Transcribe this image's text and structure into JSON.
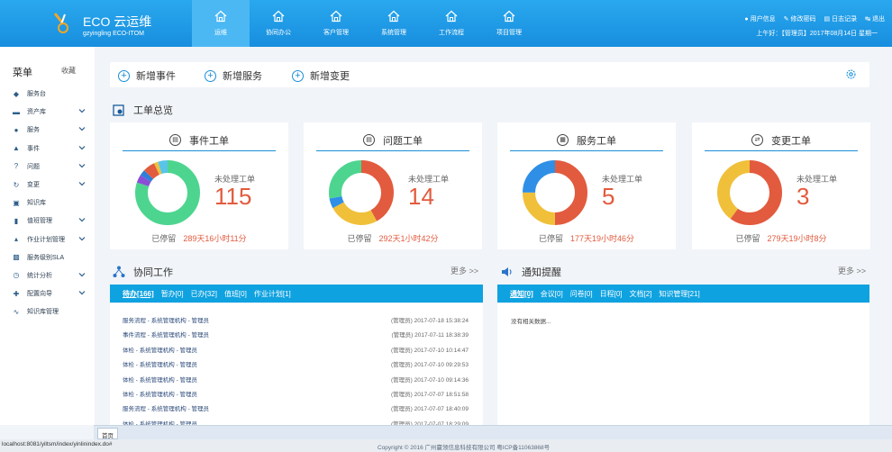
{
  "header": {
    "app_title": "ECO 云运维",
    "app_subtitle": "gzyingling ECO-ITOM",
    "nav": [
      {
        "label": "运维",
        "active": true
      },
      {
        "label": "协同办公",
        "active": false
      },
      {
        "label": "客户管理",
        "active": false
      },
      {
        "label": "系统管理",
        "active": false
      },
      {
        "label": "工作流程",
        "active": false
      },
      {
        "label": "项目管理",
        "active": false
      }
    ],
    "links": {
      "user_info": "用户信息",
      "change_password": "修改密码",
      "log": "日志记录",
      "logout": "退出"
    },
    "greeting": "上午好：【管理员】2017年08月14日  星期一",
    "colors": {
      "bar": "#1a94e2",
      "active_tab": "#4bb8f4"
    }
  },
  "sidebar": {
    "title": "菜单",
    "collapse": "收藏",
    "items": [
      {
        "label": "服务台",
        "icon": "layers-icon",
        "expandable": false
      },
      {
        "label": "资产库",
        "icon": "folder-icon",
        "expandable": true
      },
      {
        "label": "服务",
        "icon": "chat-icon",
        "expandable": true
      },
      {
        "label": "事件",
        "icon": "warning-icon",
        "expandable": true
      },
      {
        "label": "问题",
        "icon": "question-icon",
        "expandable": true
      },
      {
        "label": "变更",
        "icon": "sync-icon",
        "expandable": true
      },
      {
        "label": "知识库",
        "icon": "briefcase-icon",
        "expandable": false
      },
      {
        "label": "值班管理",
        "icon": "bookmark-icon",
        "expandable": true
      },
      {
        "label": "作业计划管理",
        "icon": "upload-icon",
        "expandable": true
      },
      {
        "label": "服务级别SLA",
        "icon": "chart-icon",
        "expandable": false
      },
      {
        "label": "统计分析",
        "icon": "clock-icon",
        "expandable": true
      },
      {
        "label": "配置向导",
        "icon": "move-icon",
        "expandable": true
      },
      {
        "label": "知识库管理",
        "icon": "line-chart-icon",
        "expandable": false
      }
    ]
  },
  "quick": {
    "new_event": "新增事件",
    "new_service": "新增服务",
    "new_change": "新增变更"
  },
  "overview": {
    "title": "工单总览",
    "pending_label": "未处理工单",
    "stay_label": "已停留",
    "cards": [
      {
        "title": "事件工单",
        "count": "115",
        "stay": "289天16小时11分"
      },
      {
        "title": "问题工单",
        "count": "14",
        "stay": "292天1小时42分"
      },
      {
        "title": "服务工单",
        "count": "5",
        "stay": "177天19小时46分"
      },
      {
        "title": "变更工单",
        "count": "3",
        "stay": "279天19小时8分"
      }
    ]
  },
  "chart_data": [
    {
      "type": "pie",
      "colors": [
        "#4dd58f",
        "#8a4fd6",
        "#2f7fd9",
        "#e25b3e",
        "#f0c03a",
        "#58c4e8"
      ],
      "values": [
        80,
        4,
        3,
        6,
        2,
        5
      ]
    },
    {
      "type": "pie",
      "colors": [
        "#e25b3e",
        "#f0c03a",
        "#2f8fe6",
        "#4dd58f"
      ],
      "values": [
        42,
        25,
        5,
        28
      ]
    },
    {
      "type": "pie",
      "colors": [
        "#e25b3e",
        "#f0c03a",
        "#2f8fe6"
      ],
      "values": [
        50,
        25,
        25
      ]
    },
    {
      "type": "pie",
      "colors": [
        "#e25b3e",
        "#f0c03a"
      ],
      "values": [
        60,
        40
      ]
    }
  ],
  "collab": {
    "title": "协同工作",
    "more": "更多 >>",
    "tabs": [
      "待办[166]",
      "暂办[0]",
      "已办[32]",
      "值班[0]",
      "作业计划[1]"
    ],
    "rows": [
      {
        "text": "服务流程 - 系统管理机构 - 管理员",
        "date": "(管理员) 2017-07-18 15:38:24"
      },
      {
        "text": "事件流程 - 系统管理机构 - 管理员",
        "date": "(管理员) 2017-07-11 18:38:39"
      },
      {
        "text": "体检 - 系统管理机构 - 管理员",
        "date": "(管理员) 2017-07-10 10:14:47"
      },
      {
        "text": "体检 - 系统管理机构 - 管理员",
        "date": "(管理员) 2017-07-10 09:29:53"
      },
      {
        "text": "体检 - 系统管理机构 - 管理员",
        "date": "(管理员) 2017-07-10 09:14:36"
      },
      {
        "text": "体检 - 系统管理机构 - 管理员",
        "date": "(管理员) 2017-07-07 18:51:58"
      },
      {
        "text": "服务流程 - 系统管理机构 - 管理员",
        "date": "(管理员) 2017-07-07 18:40:09"
      },
      {
        "text": "体检 - 系统管理机构 - 管理员",
        "date": "(管理员) 2017-07-07 18:29:09"
      }
    ]
  },
  "notice": {
    "title": "通知提醒",
    "more": "更多 >>",
    "tabs": [
      "通知[0]",
      "会议[0]",
      "问卷[0]",
      "日程[0]",
      "文档[2]",
      "知识管理[21]"
    ],
    "empty": "没有相关数据..."
  },
  "bottom": {
    "home_tab": "首页",
    "status_url": "localhost:8081/yiltsm/index/yinlinindex.do#",
    "copyright": "Copyright © 2016 广州赢领信息科技有限公司 粤ICP备11063868号"
  }
}
